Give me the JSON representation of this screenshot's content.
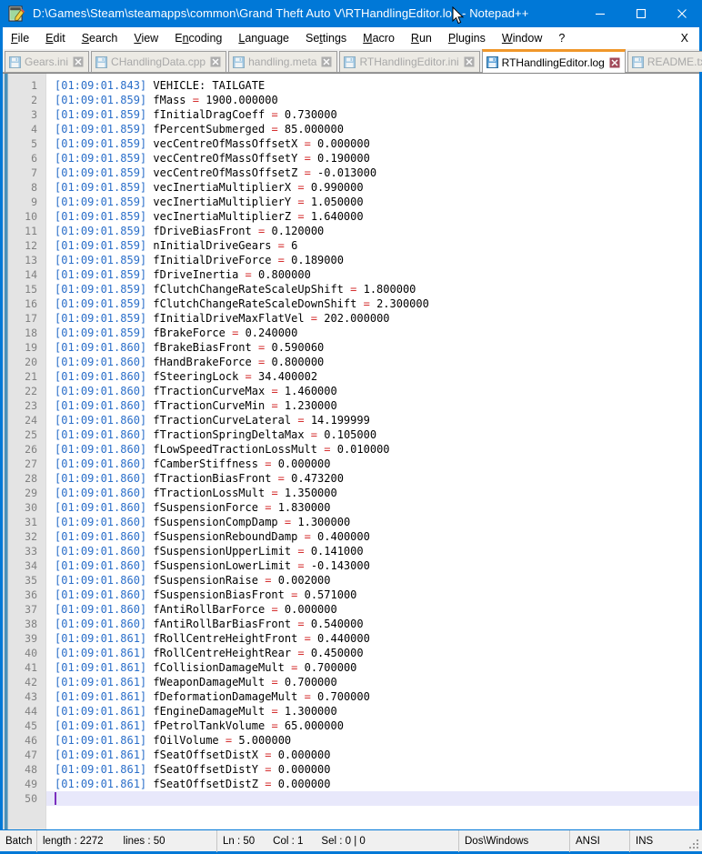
{
  "window": {
    "title": "D:\\Games\\Steam\\steamapps\\common\\Grand Theft Auto V\\RTHandlingEditor.log - Notepad++",
    "app_icon": "notepad-plus-plus-icon",
    "minimize_label": "Minimize",
    "maximize_label": "Maximize",
    "close_label": "Close",
    "accent_color": "#0078d7"
  },
  "menubar": {
    "items": [
      {
        "label": "File",
        "accel": "F"
      },
      {
        "label": "Edit",
        "accel": "E"
      },
      {
        "label": "Search",
        "accel": "S"
      },
      {
        "label": "View",
        "accel": "V"
      },
      {
        "label": "Encoding",
        "accel": "n"
      },
      {
        "label": "Language",
        "accel": "L"
      },
      {
        "label": "Settings",
        "accel": "t"
      },
      {
        "label": "Macro",
        "accel": "M"
      },
      {
        "label": "Run",
        "accel": "R"
      },
      {
        "label": "Plugins",
        "accel": "P"
      },
      {
        "label": "Window",
        "accel": "W"
      },
      {
        "label": "?",
        "accel": ""
      }
    ],
    "close_document_label": "X"
  },
  "tabs": {
    "active_index": 4,
    "active_border_color": "#f0972a",
    "items": [
      {
        "label": "Gears.ini",
        "active": false
      },
      {
        "label": "CHandlingData.cpp",
        "active": false
      },
      {
        "label": "handling.meta",
        "active": false
      },
      {
        "label": "RTHandlingEditor.ini",
        "active": false
      },
      {
        "label": "RTHandlingEditor.log",
        "active": true
      },
      {
        "label": "README.txt",
        "active": false
      }
    ]
  },
  "editor": {
    "timestamp_color": "#2a6ec9",
    "operator_color": "#d42f2f",
    "current_line_highlight": "#e8e8fb",
    "caret_color": "#7b2fbe",
    "current_line": 50,
    "lines": [
      {
        "n": 1,
        "ts": "[01:09:01.843]",
        "id": "VEHICLE: TAILGATE",
        "eq": "",
        "val": ""
      },
      {
        "n": 2,
        "ts": "[01:09:01.859]",
        "id": "fMass",
        "eq": "=",
        "val": "1900.000000"
      },
      {
        "n": 3,
        "ts": "[01:09:01.859]",
        "id": "fInitialDragCoeff",
        "eq": "=",
        "val": "0.730000"
      },
      {
        "n": 4,
        "ts": "[01:09:01.859]",
        "id": "fPercentSubmerged",
        "eq": "=",
        "val": "85.000000"
      },
      {
        "n": 5,
        "ts": "[01:09:01.859]",
        "id": "vecCentreOfMassOffsetX",
        "eq": "=",
        "val": "0.000000"
      },
      {
        "n": 6,
        "ts": "[01:09:01.859]",
        "id": "vecCentreOfMassOffsetY",
        "eq": "=",
        "val": "0.190000"
      },
      {
        "n": 7,
        "ts": "[01:09:01.859]",
        "id": "vecCentreOfMassOffsetZ",
        "eq": "=",
        "val": "-0.013000"
      },
      {
        "n": 8,
        "ts": "[01:09:01.859]",
        "id": "vecInertiaMultiplierX",
        "eq": "=",
        "val": "0.990000"
      },
      {
        "n": 9,
        "ts": "[01:09:01.859]",
        "id": "vecInertiaMultiplierY",
        "eq": "=",
        "val": "1.050000"
      },
      {
        "n": 10,
        "ts": "[01:09:01.859]",
        "id": "vecInertiaMultiplierZ",
        "eq": "=",
        "val": "1.640000"
      },
      {
        "n": 11,
        "ts": "[01:09:01.859]",
        "id": "fDriveBiasFront",
        "eq": "=",
        "val": "0.120000"
      },
      {
        "n": 12,
        "ts": "[01:09:01.859]",
        "id": "nInitialDriveGears",
        "eq": "=",
        "val": "6"
      },
      {
        "n": 13,
        "ts": "[01:09:01.859]",
        "id": "fInitialDriveForce",
        "eq": "=",
        "val": "0.189000"
      },
      {
        "n": 14,
        "ts": "[01:09:01.859]",
        "id": "fDriveInertia",
        "eq": "=",
        "val": "0.800000"
      },
      {
        "n": 15,
        "ts": "[01:09:01.859]",
        "id": "fClutchChangeRateScaleUpShift",
        "eq": "=",
        "val": "1.800000"
      },
      {
        "n": 16,
        "ts": "[01:09:01.859]",
        "id": "fClutchChangeRateScaleDownShift",
        "eq": "=",
        "val": "2.300000"
      },
      {
        "n": 17,
        "ts": "[01:09:01.859]",
        "id": "fInitialDriveMaxFlatVel",
        "eq": "=",
        "val": "202.000000"
      },
      {
        "n": 18,
        "ts": "[01:09:01.859]",
        "id": "fBrakeForce",
        "eq": "=",
        "val": "0.240000"
      },
      {
        "n": 19,
        "ts": "[01:09:01.860]",
        "id": "fBrakeBiasFront",
        "eq": "=",
        "val": "0.590060"
      },
      {
        "n": 20,
        "ts": "[01:09:01.860]",
        "id": "fHandBrakeForce",
        "eq": "=",
        "val": "0.800000"
      },
      {
        "n": 21,
        "ts": "[01:09:01.860]",
        "id": "fSteeringLock",
        "eq": "=",
        "val": "34.400002"
      },
      {
        "n": 22,
        "ts": "[01:09:01.860]",
        "id": "fTractionCurveMax",
        "eq": "=",
        "val": "1.460000"
      },
      {
        "n": 23,
        "ts": "[01:09:01.860]",
        "id": "fTractionCurveMin",
        "eq": "=",
        "val": "1.230000"
      },
      {
        "n": 24,
        "ts": "[01:09:01.860]",
        "id": "fTractionCurveLateral",
        "eq": "=",
        "val": "14.199999"
      },
      {
        "n": 25,
        "ts": "[01:09:01.860]",
        "id": "fTractionSpringDeltaMax",
        "eq": "=",
        "val": "0.105000"
      },
      {
        "n": 26,
        "ts": "[01:09:01.860]",
        "id": "fLowSpeedTractionLossMult",
        "eq": "=",
        "val": "0.010000"
      },
      {
        "n": 27,
        "ts": "[01:09:01.860]",
        "id": "fCamberStiffness",
        "eq": "=",
        "val": "0.000000"
      },
      {
        "n": 28,
        "ts": "[01:09:01.860]",
        "id": "fTractionBiasFront",
        "eq": "=",
        "val": "0.473200"
      },
      {
        "n": 29,
        "ts": "[01:09:01.860]",
        "id": "fTractionLossMult",
        "eq": "=",
        "val": "1.350000"
      },
      {
        "n": 30,
        "ts": "[01:09:01.860]",
        "id": "fSuspensionForce",
        "eq": "=",
        "val": "1.830000"
      },
      {
        "n": 31,
        "ts": "[01:09:01.860]",
        "id": "fSuspensionCompDamp",
        "eq": "=",
        "val": "1.300000"
      },
      {
        "n": 32,
        "ts": "[01:09:01.860]",
        "id": "fSuspensionReboundDamp",
        "eq": "=",
        "val": "0.400000"
      },
      {
        "n": 33,
        "ts": "[01:09:01.860]",
        "id": "fSuspensionUpperLimit",
        "eq": "=",
        "val": "0.141000"
      },
      {
        "n": 34,
        "ts": "[01:09:01.860]",
        "id": "fSuspensionLowerLimit",
        "eq": "=",
        "val": "-0.143000"
      },
      {
        "n": 35,
        "ts": "[01:09:01.860]",
        "id": "fSuspensionRaise",
        "eq": "=",
        "val": "0.002000"
      },
      {
        "n": 36,
        "ts": "[01:09:01.860]",
        "id": "fSuspensionBiasFront",
        "eq": "=",
        "val": "0.571000"
      },
      {
        "n": 37,
        "ts": "[01:09:01.860]",
        "id": "fAntiRollBarForce",
        "eq": "=",
        "val": "0.000000"
      },
      {
        "n": 38,
        "ts": "[01:09:01.860]",
        "id": "fAntiRollBarBiasFront",
        "eq": "=",
        "val": "0.540000"
      },
      {
        "n": 39,
        "ts": "[01:09:01.861]",
        "id": "fRollCentreHeightFront",
        "eq": "=",
        "val": "0.440000"
      },
      {
        "n": 40,
        "ts": "[01:09:01.861]",
        "id": "fRollCentreHeightRear",
        "eq": "=",
        "val": "0.450000"
      },
      {
        "n": 41,
        "ts": "[01:09:01.861]",
        "id": "fCollisionDamageMult",
        "eq": "=",
        "val": "0.700000"
      },
      {
        "n": 42,
        "ts": "[01:09:01.861]",
        "id": "fWeaponDamageMult",
        "eq": "=",
        "val": "0.700000"
      },
      {
        "n": 43,
        "ts": "[01:09:01.861]",
        "id": "fDeformationDamageMult",
        "eq": "=",
        "val": "0.700000"
      },
      {
        "n": 44,
        "ts": "[01:09:01.861]",
        "id": "fEngineDamageMult",
        "eq": "=",
        "val": "1.300000"
      },
      {
        "n": 45,
        "ts": "[01:09:01.861]",
        "id": "fPetrolTankVolume",
        "eq": "=",
        "val": "65.000000"
      },
      {
        "n": 46,
        "ts": "[01:09:01.861]",
        "id": "fOilVolume",
        "eq": "=",
        "val": "5.000000"
      },
      {
        "n": 47,
        "ts": "[01:09:01.861]",
        "id": "fSeatOffsetDistX",
        "eq": "=",
        "val": "0.000000"
      },
      {
        "n": 48,
        "ts": "[01:09:01.861]",
        "id": "fSeatOffsetDistY",
        "eq": "=",
        "val": "0.000000"
      },
      {
        "n": 49,
        "ts": "[01:09:01.861]",
        "id": "fSeatOffsetDistZ",
        "eq": "=",
        "val": "0.000000"
      },
      {
        "n": 50,
        "ts": "",
        "id": "",
        "eq": "",
        "val": ""
      }
    ]
  },
  "statusbar": {
    "doc_type": "Batch",
    "length_label": "length : 2272",
    "lines_label": "lines : 50",
    "ln_label": "Ln : 50",
    "col_label": "Col : 1",
    "sel_label": "Sel : 0 | 0",
    "eol": "Dos\\Windows",
    "encoding": "ANSI",
    "insert_mode": "INS"
  }
}
